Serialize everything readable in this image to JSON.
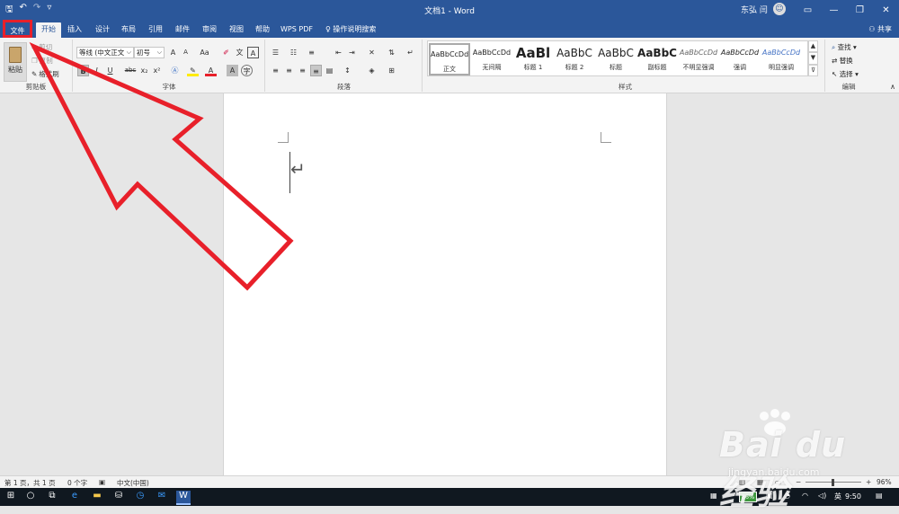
{
  "window": {
    "title": "文档1 - Word",
    "user_name": "东弘 闫",
    "share_label": "共享",
    "qat_save": "🖫",
    "qat_undo": "↶",
    "qat_redo": "↷",
    "qat_customize": "▿"
  },
  "tabs": {
    "file": "文件",
    "home": "开始",
    "insert": "插入",
    "design": "设计",
    "layout": "布局",
    "references": "引用",
    "mailings": "邮件",
    "review": "审阅",
    "view": "视图",
    "help": "帮助",
    "wps_pdf": "WPS PDF",
    "search": "操作说明搜索"
  },
  "clipboard": {
    "paste": "粘贴",
    "cut": "剪切",
    "copy": "复制",
    "format_painter": "格式刷",
    "group_label": "剪贴板"
  },
  "font": {
    "font_name": "等线 (中文正文",
    "font_size": "初号",
    "group_label": "字体",
    "bold": "B",
    "italic": "I",
    "underline": "U",
    "strike": "abc",
    "subscript": "x₂",
    "superscript": "x²",
    "grow": "A",
    "shrink": "A",
    "change_case": "Aa",
    "font_color_letter": "A"
  },
  "paragraph": {
    "group_label": "段落"
  },
  "styles": {
    "group_label": "样式",
    "items": [
      {
        "preview": "AaBbCcDd",
        "name": "正文"
      },
      {
        "preview": "AaBbCcDd",
        "name": "无间隔"
      },
      {
        "preview": "AaBl",
        "name": "标题 1"
      },
      {
        "preview": "AaBbC",
        "name": "标题 2"
      },
      {
        "preview": "AaBbC",
        "name": "标题"
      },
      {
        "preview": "AaBbC",
        "name": "副标题"
      },
      {
        "preview": "AaBbCcDd",
        "name": "不明显强调"
      },
      {
        "preview": "AaBbCcDd",
        "name": "强调"
      },
      {
        "preview": "AaBbCcDd",
        "name": "明显强调"
      }
    ]
  },
  "editing": {
    "group_label": "编辑",
    "find": "查找",
    "replace": "替换",
    "select": "选择"
  },
  "status": {
    "page": "第 1 页，共 1 页",
    "words": "0 个字",
    "language": "中文(中国)",
    "zoom": "96%"
  },
  "taskbar": {
    "battery": "86%",
    "time": "9:50"
  },
  "watermark": {
    "brand": "Bai du 经验",
    "site": "jingyan.baidu.com"
  },
  "colors": {
    "title_blue": "#2b579a",
    "highlight_red": "#e8202a"
  }
}
